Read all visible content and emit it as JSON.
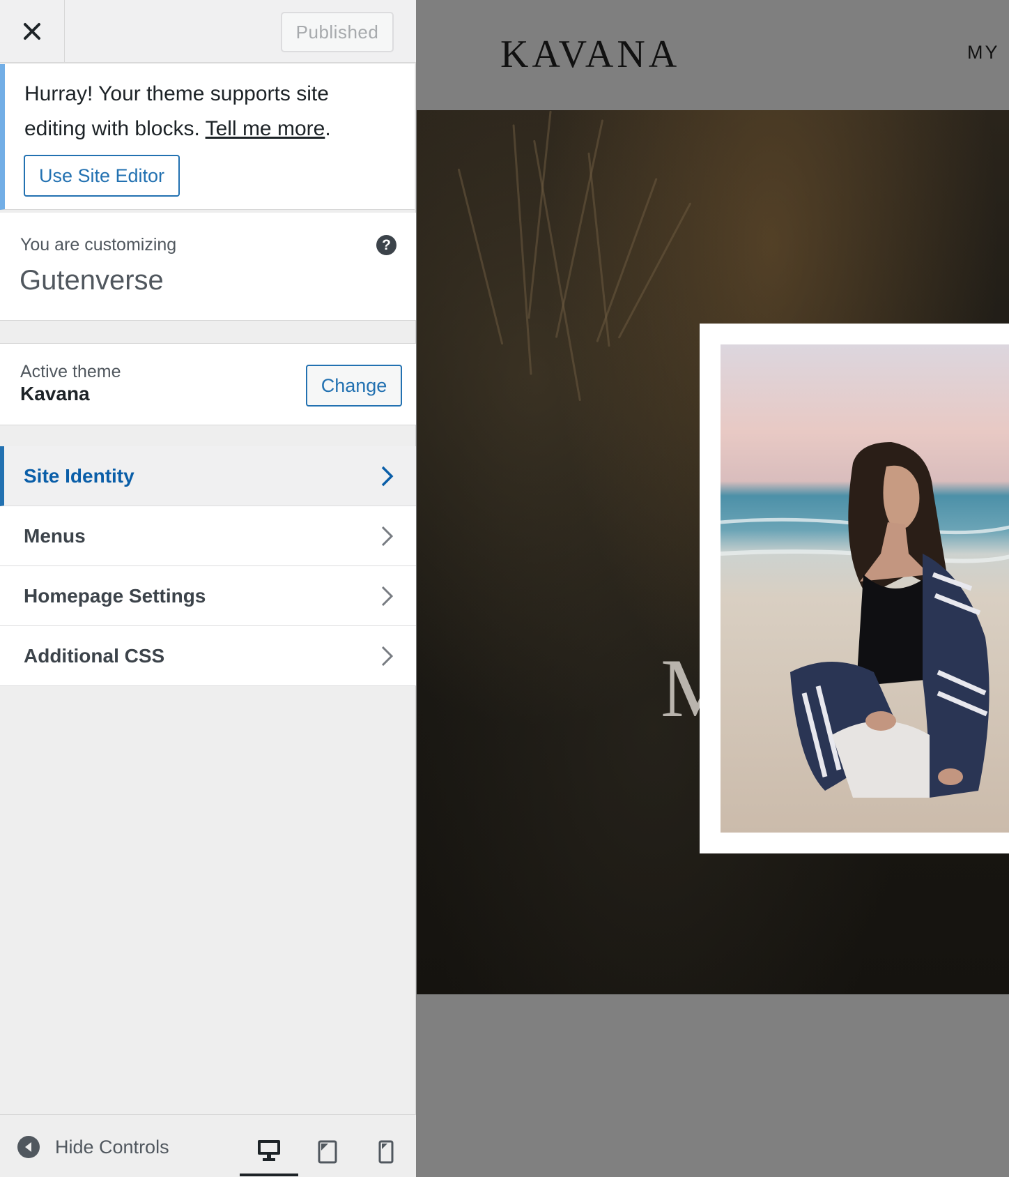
{
  "topbar": {
    "close_label": "×",
    "published_label": "Published"
  },
  "notice": {
    "text": "Hurray! Your theme supports site editing with blocks.",
    "link": "Tell me more",
    "after_link": ".",
    "button": "Use Site Editor"
  },
  "customizing": {
    "label": "You are customizing",
    "site_name": "Gutenverse",
    "help": "?"
  },
  "theme": {
    "label": "Active theme",
    "name": "Kavana",
    "change_button": "Change"
  },
  "nav": {
    "items": [
      {
        "label": "Site Identity",
        "active": true
      },
      {
        "label": "Menus",
        "active": false
      },
      {
        "label": "Homepage Settings",
        "active": false
      },
      {
        "label": "Additional CSS",
        "active": false
      }
    ]
  },
  "footer": {
    "hide_controls": "Hide Controls",
    "devices": [
      "desktop-icon",
      "tablet-icon",
      "mobile-icon"
    ],
    "active_device": "desktop"
  },
  "preview": {
    "logo": "KAVANA",
    "nav_partial": "MY",
    "hero_letter": "M"
  },
  "colors": {
    "accent": "#2271b1",
    "active_text": "#0a5ea8",
    "notice_border": "#72aee6"
  }
}
